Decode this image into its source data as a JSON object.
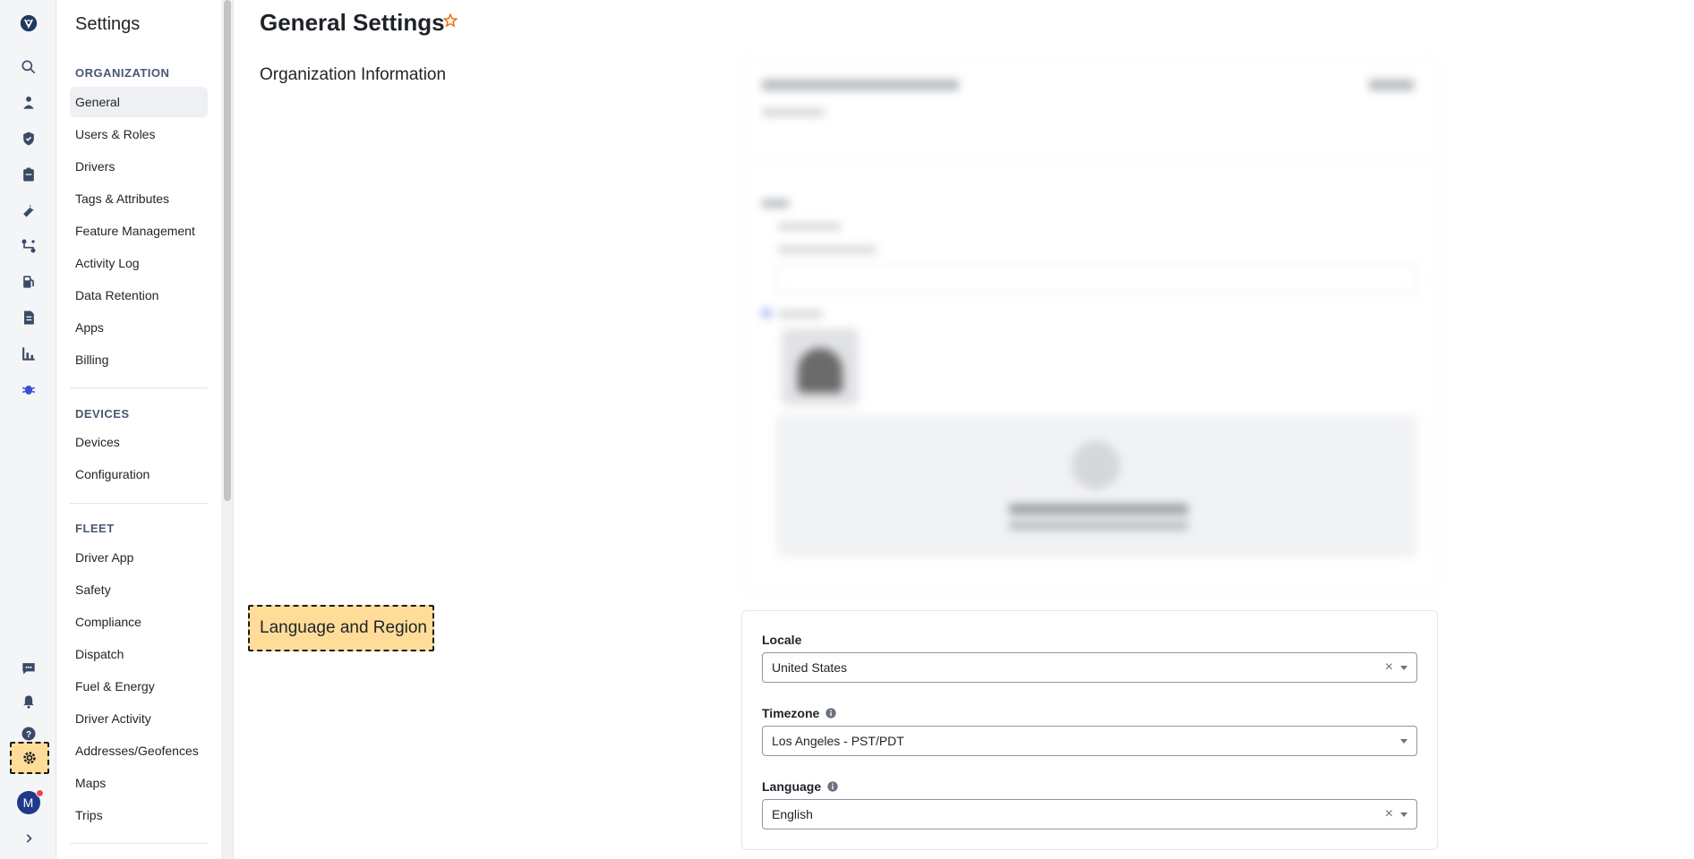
{
  "nav": {
    "title": "Settings",
    "sections": [
      {
        "heading": "ORGANIZATION",
        "items": [
          "General",
          "Users & Roles",
          "Drivers",
          "Tags & Attributes",
          "Feature Management",
          "Activity Log",
          "Data Retention",
          "Apps",
          "Billing"
        ]
      },
      {
        "heading": "DEVICES",
        "items": [
          "Devices",
          "Configuration"
        ]
      },
      {
        "heading": "FLEET",
        "items": [
          "Driver App",
          "Safety",
          "Compliance",
          "Dispatch",
          "Fuel & Energy",
          "Driver Activity",
          "Addresses/Geofences",
          "Maps",
          "Trips"
        ]
      }
    ],
    "selected_item": "General"
  },
  "rail": {
    "icons": [
      "logo-icon",
      "search-icon",
      "map-pin-person-icon",
      "shield-icon",
      "clipboard-icon",
      "wrench-icon",
      "route-icon",
      "fuel-icon",
      "document-icon",
      "bar-chart-icon",
      "bug-icon",
      "chat-icon",
      "bell-icon",
      "help-icon",
      "gear-icon",
      "avatar",
      "expand-icon"
    ],
    "avatar_initial": "M",
    "accent_color": "#1e3a8a",
    "notification_color": "#e5484d"
  },
  "main": {
    "page_title": "General Settings",
    "org_section_label": "Organization Information",
    "lang_section_label": "Language and Region",
    "locale": {
      "label": "Locale",
      "value": "United States"
    },
    "timezone": {
      "label": "Timezone",
      "value": "Los Angeles - PST/PDT"
    },
    "language": {
      "label": "Language",
      "value": "English"
    }
  }
}
